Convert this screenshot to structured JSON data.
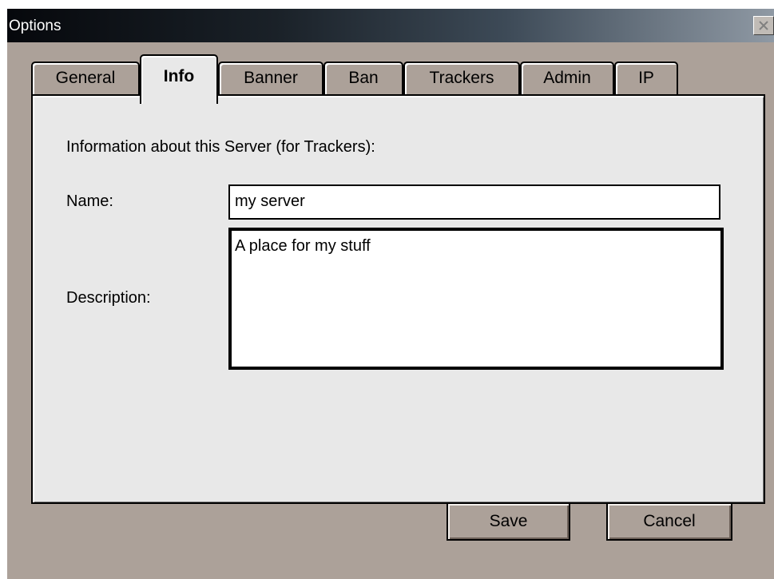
{
  "window": {
    "title": "Options"
  },
  "tabs": [
    {
      "label": "General",
      "active": false
    },
    {
      "label": "Info",
      "active": true
    },
    {
      "label": "Banner",
      "active": false
    },
    {
      "label": "Ban",
      "active": false
    },
    {
      "label": "Trackers",
      "active": false
    },
    {
      "label": "Admin",
      "active": false
    },
    {
      "label": "IP",
      "active": false
    }
  ],
  "info_panel": {
    "heading": "Information about this Server (for Trackers):",
    "name_label": "Name:",
    "name_value": "my server",
    "description_label": "Description:",
    "description_value": "A place for my stuff"
  },
  "buttons": {
    "save_label": "Save",
    "cancel_label": "Cancel"
  },
  "icons": {
    "close": "close-icon"
  },
  "colors": {
    "window_bg": "#aca199",
    "panel_bg": "#e8e8e8",
    "title_bar_start": "#06080c",
    "title_bar_end": "#8f99a4"
  }
}
